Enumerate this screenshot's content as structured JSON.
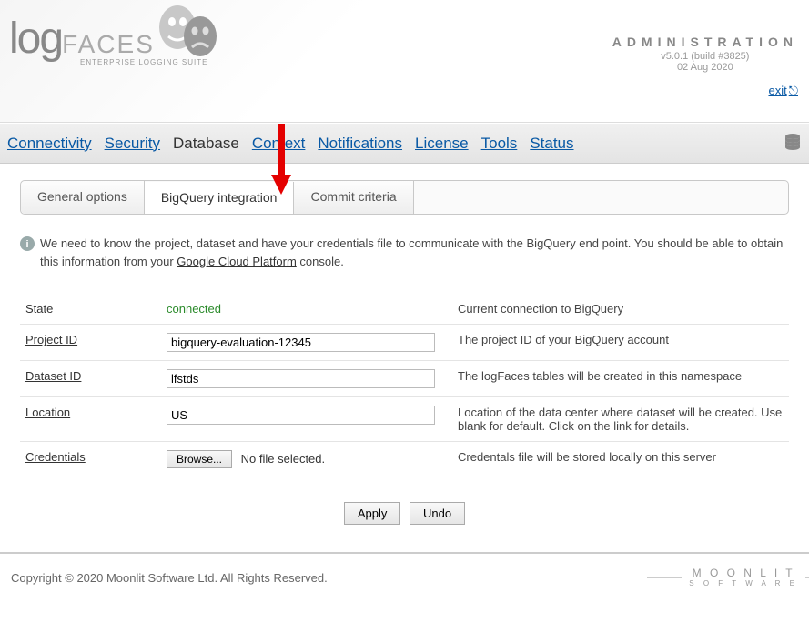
{
  "header": {
    "admin_title": "ADMINISTRATION",
    "version": "v5.0.1 (build #3825)",
    "date": "02 Aug 2020",
    "exit_label": "exit",
    "logo_main": "log",
    "logo_faces": "FACES",
    "logo_sub": "ENTERPRISE LOGGING SUITE"
  },
  "nav": {
    "items": [
      {
        "label": "Connectivity",
        "active": false
      },
      {
        "label": "Security",
        "active": false
      },
      {
        "label": "Database",
        "active": true
      },
      {
        "label": "Context",
        "active": false
      },
      {
        "label": "Notifications",
        "active": false
      },
      {
        "label": "License",
        "active": false
      },
      {
        "label": "Tools",
        "active": false
      },
      {
        "label": "Status",
        "active": false
      }
    ]
  },
  "tabs": [
    {
      "label": "General options",
      "active": false
    },
    {
      "label": "BigQuery integration",
      "active": true
    },
    {
      "label": "Commit criteria",
      "active": false
    }
  ],
  "info": {
    "text_before": "We need to know the project, dataset and have your credentials file to communicate with the BigQuery end point. You should be able to obtain this information from your ",
    "link": "Google Cloud Platform",
    "text_after": " console."
  },
  "form": {
    "state": {
      "label": "State",
      "value": "connected",
      "desc": "Current connection to BigQuery"
    },
    "project": {
      "label": "Project ID",
      "value": "bigquery-evaluation-12345",
      "desc": "The project ID of your BigQuery account"
    },
    "dataset": {
      "label": "Dataset ID",
      "value": "lfstds",
      "desc": "The logFaces tables will be created in this namespace"
    },
    "location": {
      "label": "Location",
      "value": "US",
      "desc": "Location of the data center where dataset will be created. Use blank for default. Click on the link for details."
    },
    "credentials": {
      "label": "Credentials",
      "browse": "Browse...",
      "nofile": "No file selected.",
      "desc": "Credentals file will be stored locally on this server"
    }
  },
  "actions": {
    "apply": "Apply",
    "undo": "Undo"
  },
  "footer": {
    "copyright": "Copyright © 2020 Moonlit Software Ltd. All Rights Reserved.",
    "brand": "M O O N L I T",
    "brand_sub": "S O F T W A R E"
  }
}
